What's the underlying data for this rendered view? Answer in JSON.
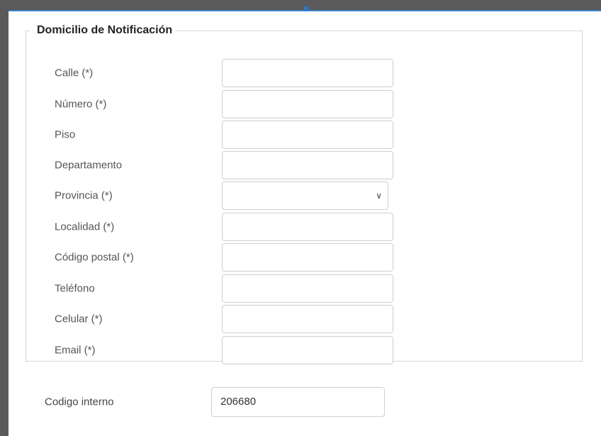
{
  "fieldset": {
    "legend": "Domicilio de Notificación",
    "fields": [
      {
        "label": "Calle (*)",
        "value": "",
        "type": "text"
      },
      {
        "label": "Número (*)",
        "value": "",
        "type": "text"
      },
      {
        "label": "Piso",
        "value": "",
        "type": "text"
      },
      {
        "label": "Departamento",
        "value": "",
        "type": "text"
      },
      {
        "label": "Provincia (*)",
        "value": "",
        "type": "select"
      },
      {
        "label": "Localidad (*)",
        "value": "",
        "type": "text"
      },
      {
        "label": "Código postal (*)",
        "value": "",
        "type": "text"
      },
      {
        "label": "Teléfono",
        "value": "",
        "type": "text"
      },
      {
        "label": "Celular (*)",
        "value": "",
        "type": "text"
      },
      {
        "label": "Email (*)",
        "value": "",
        "type": "text"
      }
    ]
  },
  "codigo_interno": {
    "label": "Codigo interno",
    "value": "206680"
  },
  "icons": {
    "select_chevron": "chevron-down-icon"
  },
  "colors": {
    "accent": "#2e76c9",
    "frame": "#5a5a5a",
    "border": "#cfcfcf"
  }
}
